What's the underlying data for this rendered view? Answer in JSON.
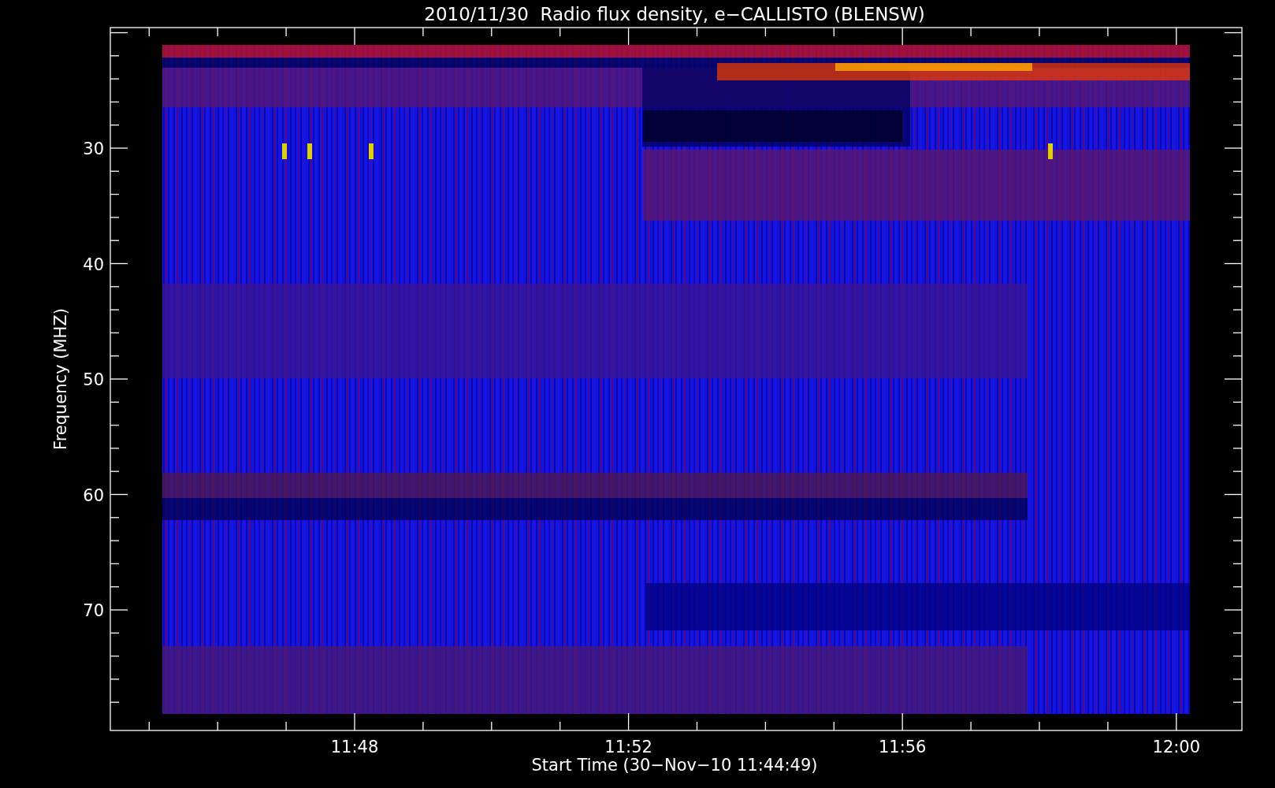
{
  "plot": {
    "title": "2010/11/30  Radio flux density, e−CALLISTO (BLENSW)",
    "xlabel": "Start Time (30−Nov−10 11:44:49)",
    "ylabel": "Frequency (MHZ)",
    "xtick_labels": [
      "11:48",
      "11:52",
      "11:56",
      "12:00"
    ],
    "ytick_labels": [
      "30",
      "40",
      "50",
      "60",
      "70"
    ]
  }
}
